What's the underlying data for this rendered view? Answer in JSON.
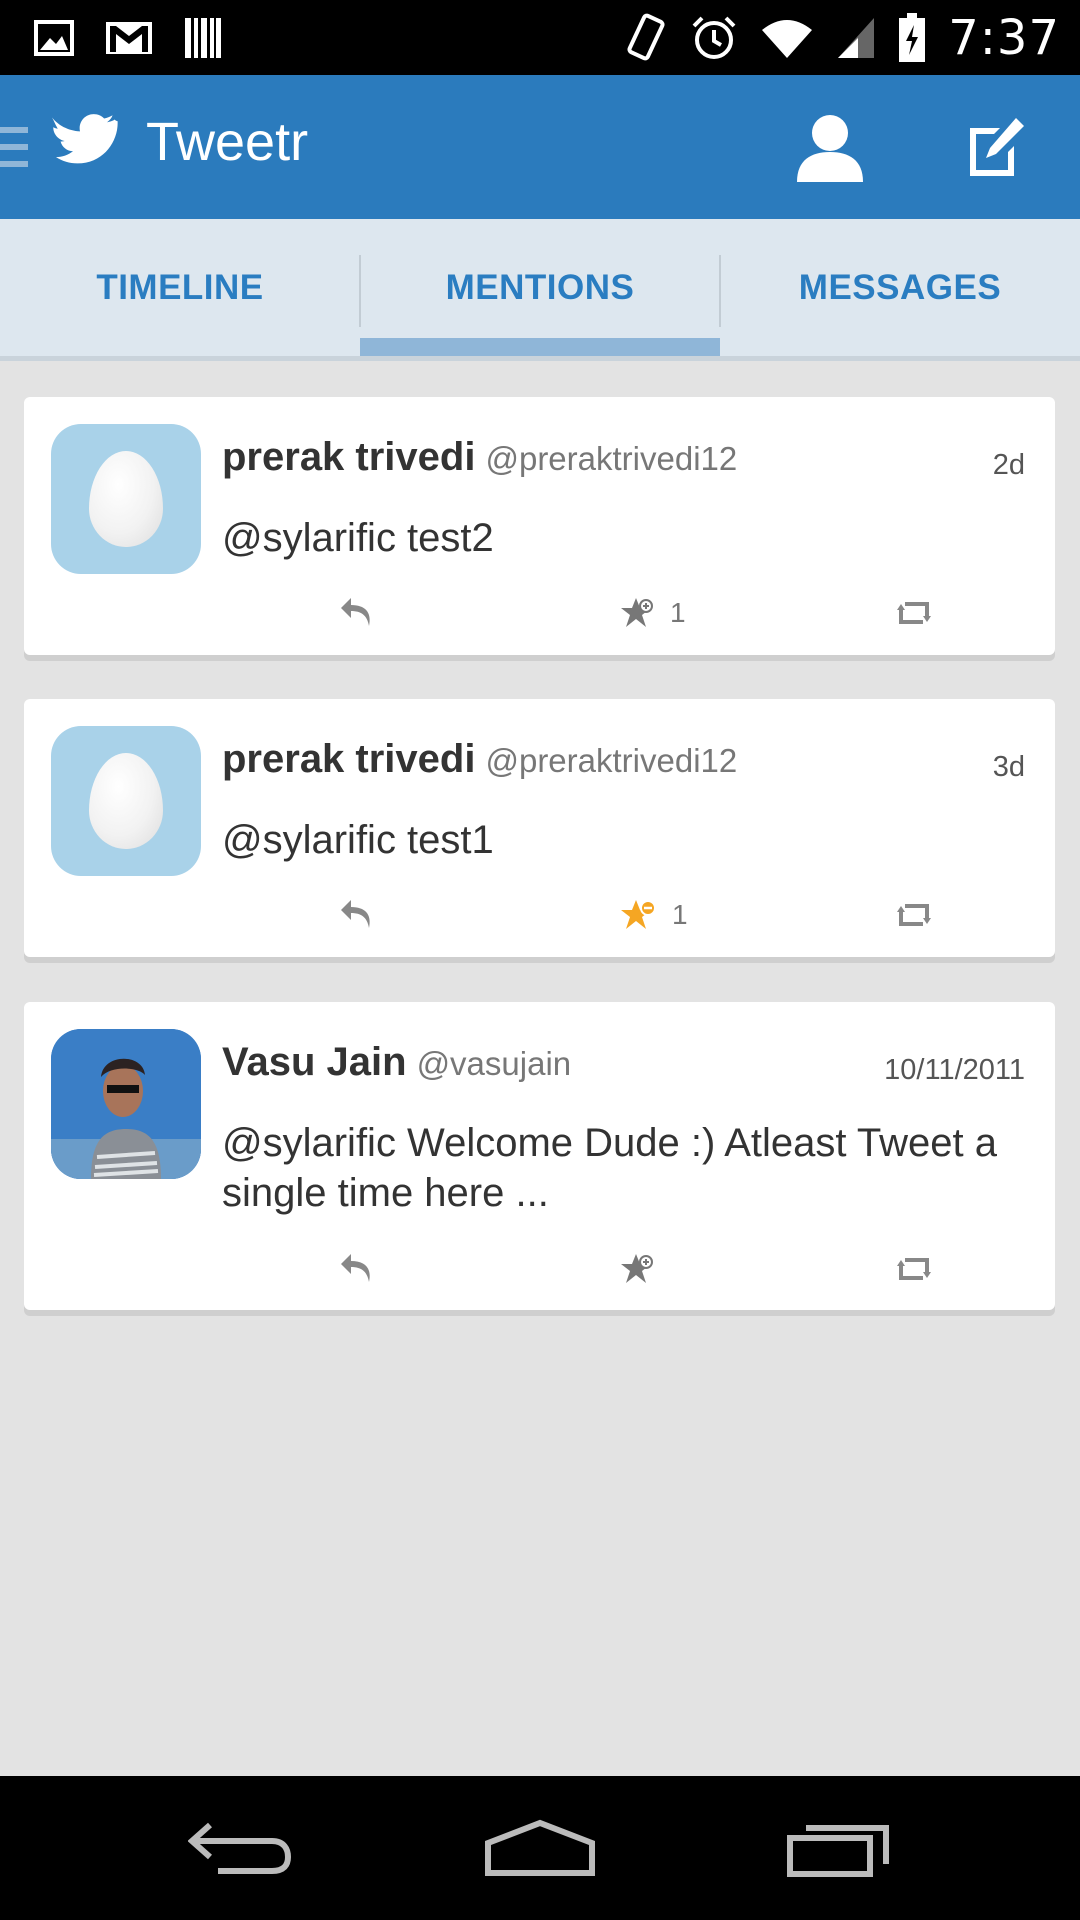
{
  "status_bar": {
    "time": "7:37"
  },
  "action_bar": {
    "title": "Tweetr"
  },
  "tabs": [
    {
      "label": "TIMELINE"
    },
    {
      "label": "MENTIONS",
      "selected": true
    },
    {
      "label": "MESSAGES"
    }
  ],
  "tweets": [
    {
      "name": "prerak trivedi",
      "handle": "@preraktrivedi12",
      "time": "2d",
      "text": "@sylarific test2",
      "favorite_count": "1",
      "favorited": false,
      "avatar": "default-egg"
    },
    {
      "name": "prerak trivedi",
      "handle": "@preraktrivedi12",
      "time": "3d",
      "text": "@sylarific test1",
      "favorite_count": "1",
      "favorited": true,
      "avatar": "default-egg"
    },
    {
      "name": "Vasu Jain",
      "handle": "@vasujain",
      "time": "10/11/2011",
      "text": "@sylarific Welcome Dude :) Atleast Tweet a single time here ...",
      "favorite_count": "",
      "favorited": false,
      "avatar": "photo"
    }
  ],
  "colors": {
    "action_bar": "#2b7bbd",
    "tab_text": "#2a7dc1",
    "favorited_star": "#f5a623",
    "background": "#e3e3e3"
  },
  "icons": [
    "image-icon",
    "gmail-icon",
    "barcode-icon",
    "vibrate-icon",
    "alarm-icon",
    "wifi-icon",
    "signal-icon",
    "battery-icon",
    "drawer-icon",
    "twitter-bird-icon",
    "profile-icon",
    "compose-icon",
    "reply-icon",
    "favorite-icon",
    "retweet-icon",
    "back-icon",
    "home-icon",
    "recents-icon"
  ]
}
